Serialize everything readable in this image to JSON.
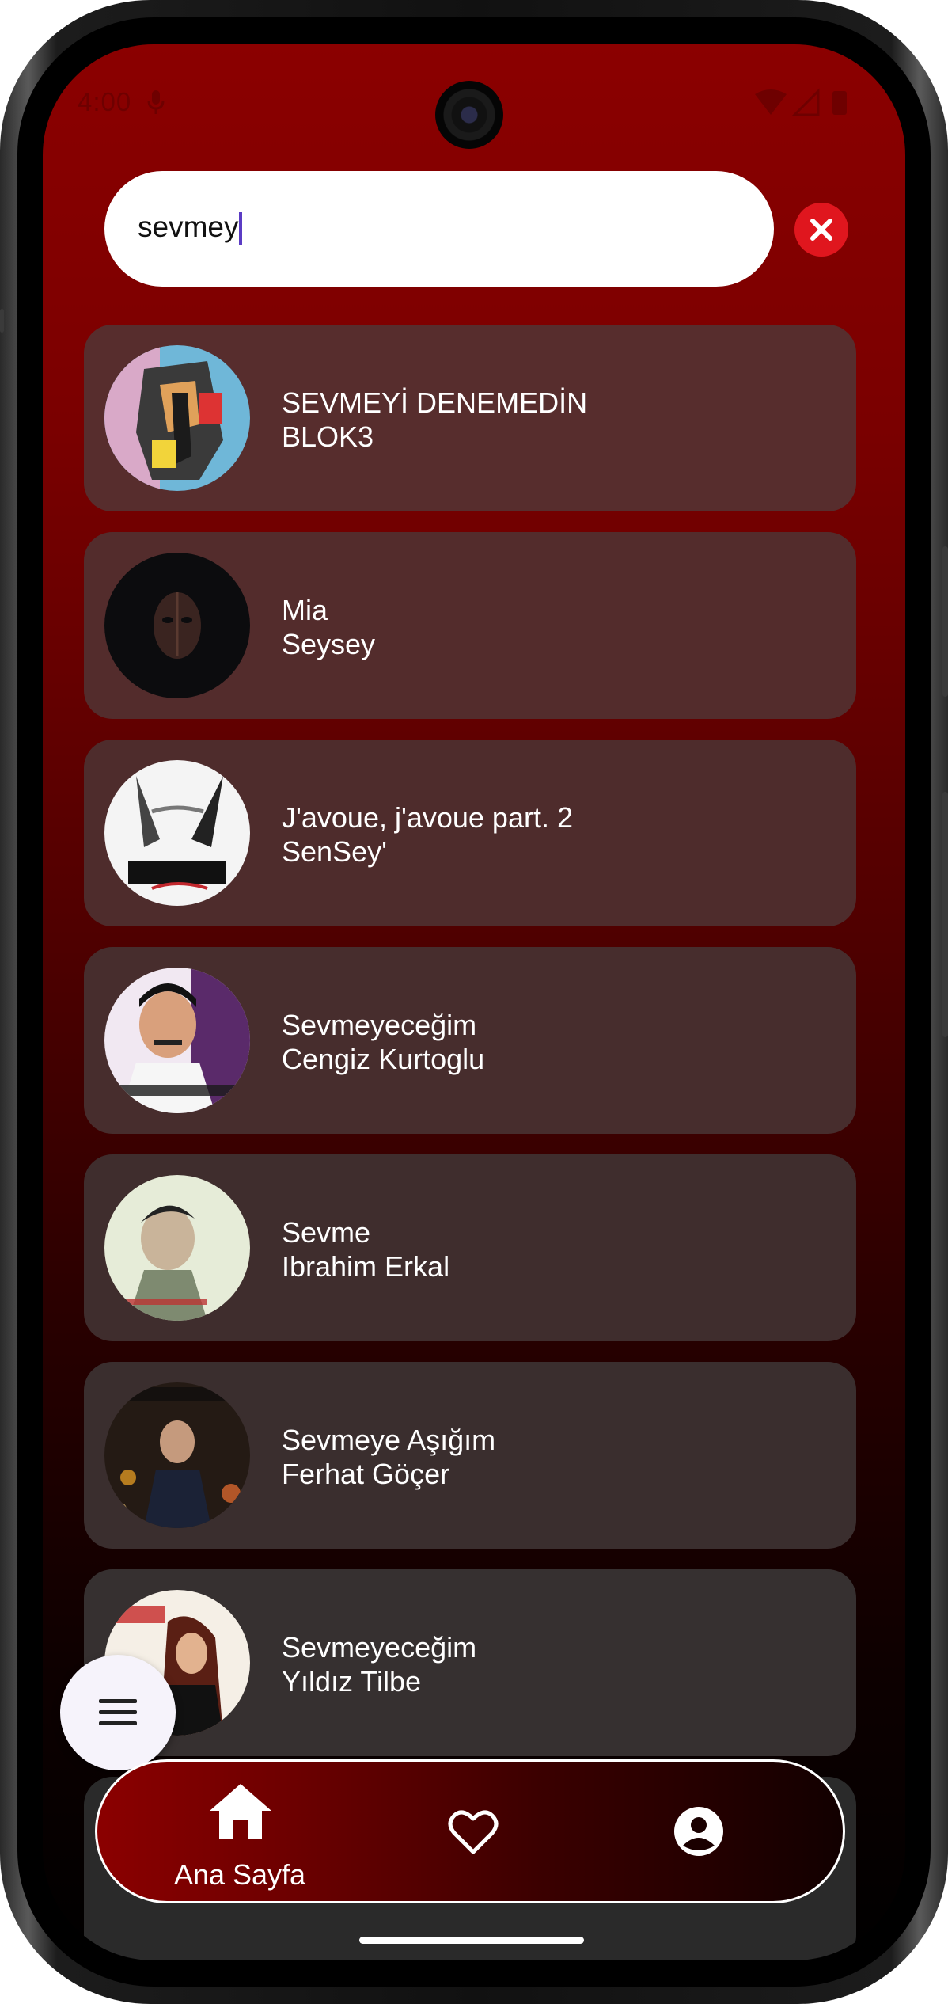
{
  "status_bar": {
    "time": "4:00"
  },
  "search": {
    "query": "sevmey"
  },
  "results": [
    {
      "title": "SEVMEYİ DENEMEDİN",
      "artist": "BLOK3",
      "card_color": "#572d2d"
    },
    {
      "title": "Mia",
      "artist": "Seysey",
      "card_color": "#532c2c"
    },
    {
      "title": "J'avoue, j'avoue part. 2",
      "artist": "SenSey'",
      "card_color": "#4e2c2c"
    },
    {
      "title": "Sevmeyeceğim",
      "artist": "Cengiz Kurtoglu",
      "card_color": "#472d2d"
    },
    {
      "title": "Sevme",
      "artist": "Ibrahim Erkal",
      "card_color": "#3f2d2d"
    },
    {
      "title": "Sevmeye Aşığım",
      "artist": "Ferhat Göçer",
      "card_color": "#3a2e2e"
    },
    {
      "title": "Sevmeyeceğim",
      "artist": "Yıldız Tilbe",
      "card_color": "#363030"
    }
  ],
  "bottom_nav": {
    "home_label": "Ana Sayfa",
    "active": "home"
  },
  "icons": {
    "fab": "menu-icon",
    "clear": "close-icon",
    "nav": [
      "home-icon",
      "heart-icon",
      "account-icon"
    ]
  },
  "colors": {
    "gradient_top": "#8b0000",
    "gradient_bottom": "#000000",
    "clear_button": "#e0161e",
    "caret": "#5b3cc4"
  }
}
